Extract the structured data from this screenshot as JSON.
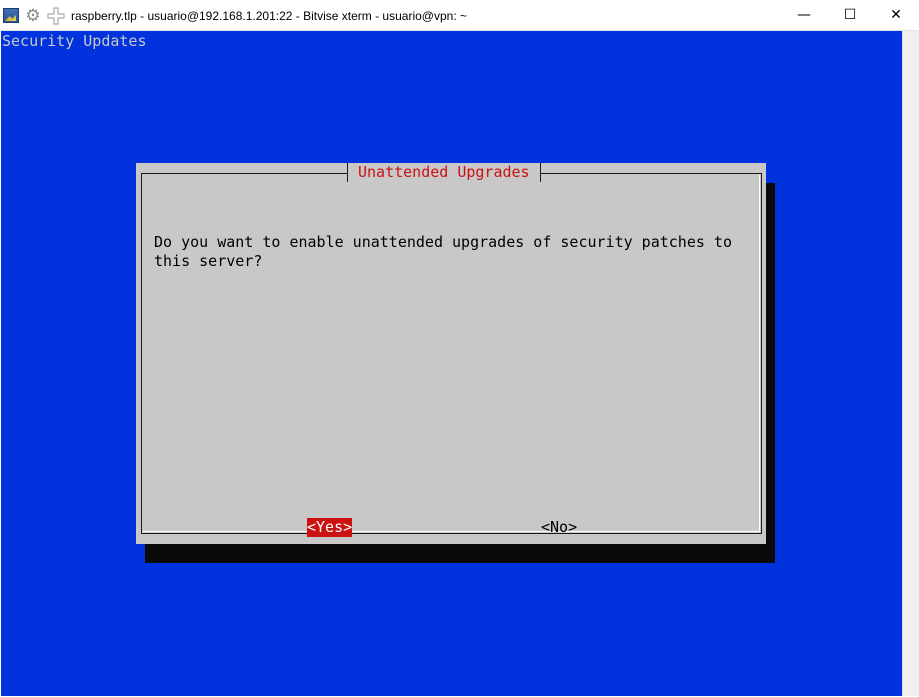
{
  "window": {
    "title": "raspberry.tlp - usuario@192.168.1.201:22 - Bitvise xterm - usuario@vpn: ~",
    "icons": [
      "bitvise-app-icon",
      "gear-icon",
      "move-icon"
    ],
    "controls": {
      "minimize": "—",
      "maximize": "☐",
      "close": "✕"
    }
  },
  "terminal": {
    "background": "#0033dd",
    "backtitle": "Security Updates"
  },
  "dialog": {
    "title": "Unattended Upgrades",
    "message": "Do you want to enable unattended upgrades of security patches to\nthis server?",
    "buttons": {
      "yes": "<Yes>",
      "no": "<No>"
    },
    "selected": "yes",
    "colors": {
      "background": "#c8c8c8",
      "title": "#cc1111",
      "selected_button": "#cc1111",
      "shadow": "#0a0a0a"
    }
  }
}
